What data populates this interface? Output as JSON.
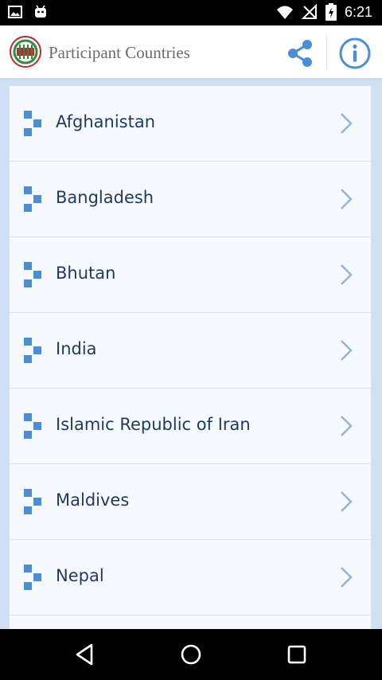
{
  "status_bar": {
    "time": "6:21",
    "left_icons": [
      "image-notification-icon",
      "android-notification-icon"
    ],
    "right_icons": [
      "wifi-icon",
      "no-signal-icon",
      "battery-charging-icon"
    ]
  },
  "app_bar": {
    "title": "Participant Countries",
    "logo_icon": "saarc-logo",
    "actions": [
      "share-icon",
      "info-icon"
    ]
  },
  "countries": [
    "Afghanistan",
    "Bangladesh",
    "Bhutan",
    "India",
    "Islamic Republic of Iran",
    "Maldives",
    "Nepal"
  ],
  "nav_bar": {
    "buttons": [
      "back-icon",
      "home-icon",
      "recents-icon"
    ]
  },
  "colors": {
    "accent": "#4a8fd6",
    "text": "#1f3a5f",
    "list_bg": "#f6f9fd",
    "page_bg": "#cfe0f3"
  }
}
